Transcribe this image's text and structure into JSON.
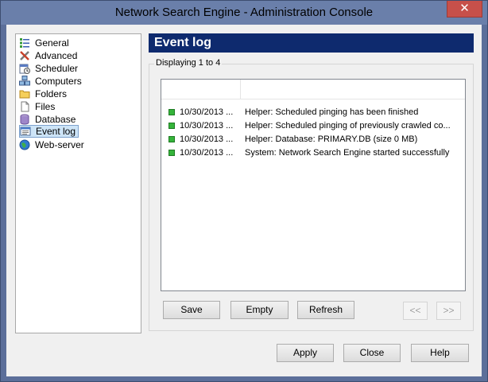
{
  "window": {
    "title": "Network Search Engine - Administration Console",
    "close_glyph": "✕"
  },
  "sidebar": {
    "items": [
      {
        "label": "General",
        "icon": "list-icon"
      },
      {
        "label": "Advanced",
        "icon": "tools-icon"
      },
      {
        "label": "Scheduler",
        "icon": "clock-icon"
      },
      {
        "label": "Computers",
        "icon": "computers-icon"
      },
      {
        "label": "Folders",
        "icon": "folder-icon"
      },
      {
        "label": "Files",
        "icon": "file-icon"
      },
      {
        "label": "Database",
        "icon": "database-icon"
      },
      {
        "label": "Event log",
        "icon": "event-log-icon",
        "selected": true
      },
      {
        "label": "Web-server",
        "icon": "globe-icon"
      }
    ]
  },
  "panel": {
    "title": "Event log",
    "caption": "Displaying 1 to 4",
    "log": [
      {
        "datetime": "10/30/2013 ...",
        "message": "Helper: Scheduled pinging has been finished",
        "status": "ok"
      },
      {
        "datetime": "10/30/2013 ...",
        "message": "Helper: Scheduled pinging of previously crawled co...",
        "status": "ok"
      },
      {
        "datetime": "10/30/2013 ...",
        "message": "Helper: Database: PRIMARY.DB (size 0 MB)",
        "status": "ok"
      },
      {
        "datetime": "10/30/2013 ...",
        "message": "System: Network Search Engine started successfully",
        "status": "ok"
      }
    ],
    "buttons": {
      "save": "Save",
      "empty": "Empty",
      "refresh": "Refresh",
      "prev": "<<",
      "next": ">>"
    }
  },
  "footer": {
    "apply": "Apply",
    "close": "Close",
    "help": "Help"
  },
  "colors": {
    "header_bg": "#0e2a6e",
    "status_ok": "#35b43a",
    "selection_bg": "#cde4f7"
  }
}
